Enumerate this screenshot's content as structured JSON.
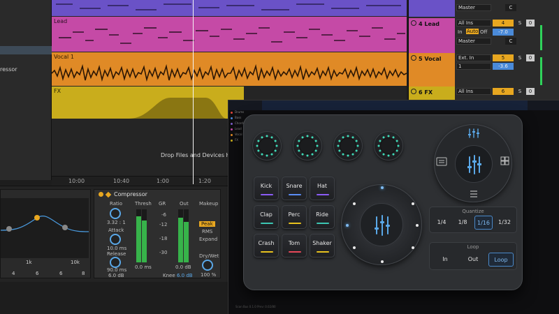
{
  "arrangement": {
    "tracks": [
      {
        "name": "",
        "color": "#6a52c7"
      },
      {
        "name": "Lead",
        "color": "#c54aa6"
      },
      {
        "name": "Vocal 1",
        "color": "#e08a26"
      },
      {
        "name": "FX",
        "color": "#c9ad1c"
      }
    ],
    "drop_hint": "Drop Files and Devices Here",
    "ruler_ticks": [
      "10:00",
      "10:40",
      "1:00",
      "1:20"
    ],
    "browser_item": "ressor"
  },
  "mixer": {
    "rows": [
      {
        "track_name": "",
        "color": "#6a52c7",
        "input": "",
        "routing": "Master",
        "num": "",
        "pan": "C",
        "extra": ""
      },
      {
        "track_name": "4 Lead",
        "color": "#c54aa6",
        "input": "All Ins",
        "monitor": [
          "In",
          "Auto",
          "Off"
        ],
        "routing": "Master",
        "num": "4",
        "s": "S",
        "zero": "0",
        "vol": "-7.0",
        "pan": "C"
      },
      {
        "track_name": "5 Vocal",
        "color": "#e08a26",
        "input": "Ext. In",
        "channel": "1",
        "num": "5",
        "s": "S",
        "zero": "0",
        "vol": "-3.6",
        "pan": "C"
      },
      {
        "track_name": "6 FX",
        "color": "#c9ad1c",
        "input": "All Ins",
        "num": "6",
        "s": "S",
        "zero": "0"
      }
    ]
  },
  "eq": {
    "freq_labels": [
      "1k",
      "10k"
    ],
    "band_numbers": [
      "4",
      "6",
      "6",
      "8"
    ]
  },
  "compressor": {
    "title": "Compressor",
    "ratio_label": "Ratio",
    "ratio_value": "3.32 : 1",
    "attack_label": "Attack",
    "attack_value": "10.0 ms",
    "release_label": "Release",
    "release_value": "90.0 ms",
    "release_db": "6.0 dB",
    "thresh_label": "Thresh",
    "gr_label": "GR",
    "out_label": "Out",
    "scale": [
      "-6",
      "-12",
      "-18",
      "-30"
    ],
    "thresh_value": "0.0 ms",
    "out_value": "0.0 dB",
    "knee_label": "Knee",
    "knee_value": "6.0 dB",
    "makeup_label": "Makeup",
    "peak_label": "Peak",
    "rms_label": "RMS",
    "expand_label": "Expand",
    "drywet_label": "Dry/Wet",
    "drywet_value": "100 %"
  },
  "plugin": {
    "side_items": [
      "Drums",
      "Bass",
      "Chords",
      "Lead",
      "Vocal",
      "FX"
    ],
    "side_colors": [
      "#e0453a",
      "#4a8ad9",
      "#7c5ec9",
      "#c54aa6",
      "#e08a26",
      "#c9ad1c"
    ],
    "status": "Scan Bus 0.1.0 Prev: 0.02/80"
  },
  "controller": {
    "pads": [
      {
        "label": "Kick",
        "color": "#8b5cf6"
      },
      {
        "label": "Snare",
        "color": "#5b8df6"
      },
      {
        "label": "Hat",
        "color": "#8b5cf6"
      },
      {
        "label": "Clap",
        "color": "#3cc6b3"
      },
      {
        "label": "Perc",
        "color": "#e8c21e"
      },
      {
        "label": "Ride",
        "color": "#3cc6b3"
      },
      {
        "label": "Crash",
        "color": "#e8c21e"
      },
      {
        "label": "Tom",
        "color": "#e8485a"
      },
      {
        "label": "Shaker",
        "color": "#e8c21e"
      }
    ],
    "quantize": {
      "title": "Quantize",
      "options": [
        "1/4",
        "1/8",
        "1/16",
        "1/32"
      ],
      "selected": "1/16"
    },
    "loop": {
      "title": "Loop",
      "options": [
        "In",
        "Out",
        "Loop"
      ],
      "selected": "Loop"
    },
    "accent_color": "#3fdcb8",
    "highlight_color": "#5aa8e8"
  }
}
